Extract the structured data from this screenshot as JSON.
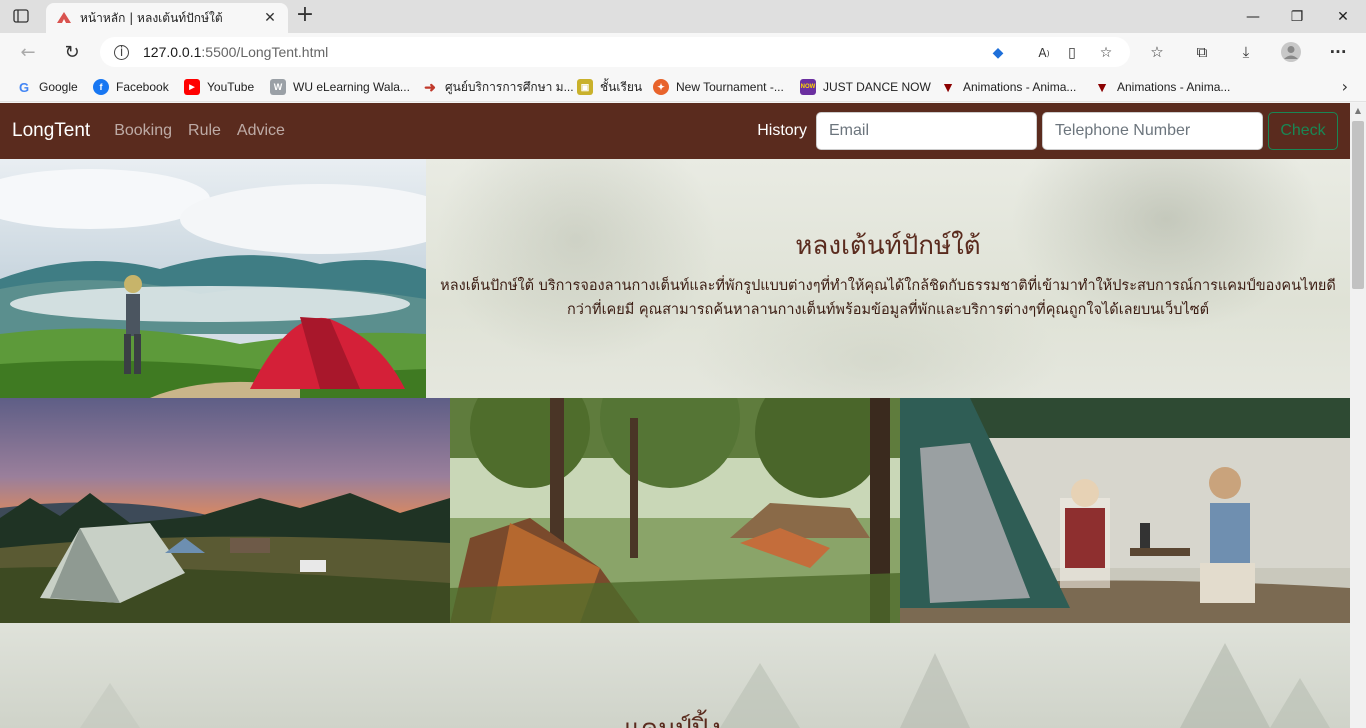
{
  "browser": {
    "tab": {
      "title": "หน้าหลัก | หลงเต้นท์ปักษ์ใต้"
    },
    "address": {
      "host": "127.0.0.1",
      "path": ":5500/LongTent.html"
    },
    "bookmarks": [
      {
        "label": "Google",
        "color": "#4285f4"
      },
      {
        "label": "Facebook",
        "color": "#1877f2"
      },
      {
        "label": "YouTube",
        "color": "#ff0000"
      },
      {
        "label": "WU eLearning Wala...",
        "color": "#888888"
      },
      {
        "label": "ศูนย์บริการการศึกษา ม...",
        "color": "#c0392b"
      },
      {
        "label": "ชั้นเรียน",
        "color": "#c9b12b"
      },
      {
        "label": "New Tournament -...",
        "color": "#e8632b"
      },
      {
        "label": "JUST DANCE NOW",
        "color": "#6b2fa0"
      },
      {
        "label": "Animations - Anima...",
        "color": "#8b0000"
      },
      {
        "label": "Animations - Anima...",
        "color": "#8b0000"
      }
    ]
  },
  "navbar": {
    "brand": "LongTent",
    "links": [
      "Booking",
      "Rule",
      "Advice"
    ],
    "history_label": "History",
    "email_placeholder": "Email",
    "phone_placeholder": "Telephone Number",
    "check_label": "Check"
  },
  "hero": {
    "title": "หลงเต้นท์ปักษ์ใต้",
    "description": "หลงเต็นปักษ์ใต้ บริการจองลานกางเต็นท์และที่พักรูปแบบต่างๆที่ทำให้คุณได้ใกล้ชิดกับธรรมชาติที่เข้ามาทำให้ประสบการณ์การแคมป์ของคนไทยดีกว่าที่เคยมี คุณสามารถค้นหาลานกางเต็นท์พร้อมข้อมูลที่พักและบริการต่างๆที่คุณถูกใจได้เลยบนเว็บไซต์"
  },
  "section2": {
    "title": "แคมป์ปิ้ง"
  },
  "colors": {
    "navbar": "#5a2b1e",
    "check": "#198754",
    "heading": "#5a2b1e"
  }
}
